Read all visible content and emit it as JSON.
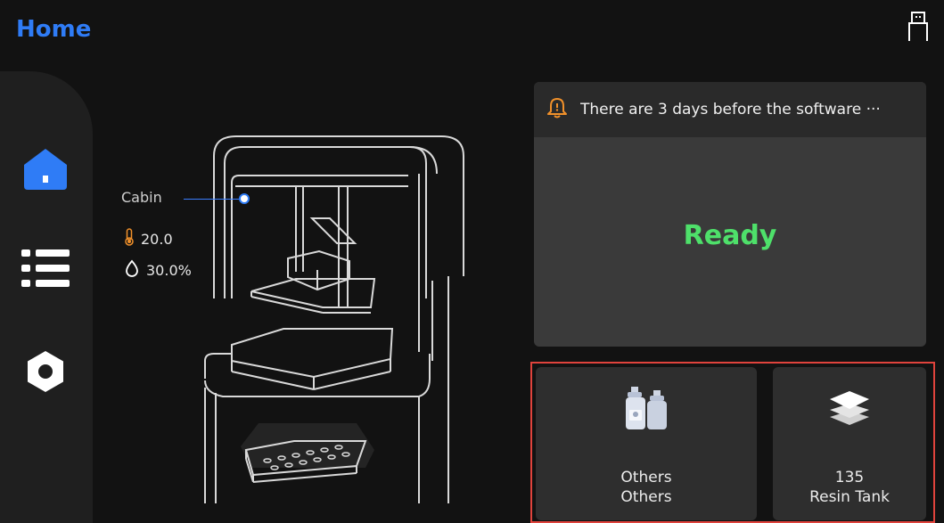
{
  "header": {
    "title": "Home",
    "usb_icon": "usb-icon"
  },
  "sidebar": {
    "items": [
      {
        "name": "home",
        "icon": "home-icon",
        "active": true
      },
      {
        "name": "list",
        "icon": "list-icon",
        "active": false
      },
      {
        "name": "settings",
        "icon": "gear-icon",
        "active": false
      }
    ]
  },
  "cabin": {
    "label": "Cabin",
    "temperature": "20.0",
    "humidity": "30.0%"
  },
  "notice": {
    "icon": "bell-icon",
    "text": "There are 3 days before the software ···"
  },
  "status": {
    "text": "Ready",
    "color": "#4ee06a"
  },
  "cards": {
    "resin_kind": {
      "icon": "bottles-icon",
      "line1": "Others",
      "line2": "Others"
    },
    "resin_tank": {
      "icon": "layers-icon",
      "line1": "135",
      "line2": "Resin Tank"
    }
  },
  "colors": {
    "accent": "#2f7cf6",
    "highlight": "#e0433c",
    "warning": "#f0902a"
  }
}
